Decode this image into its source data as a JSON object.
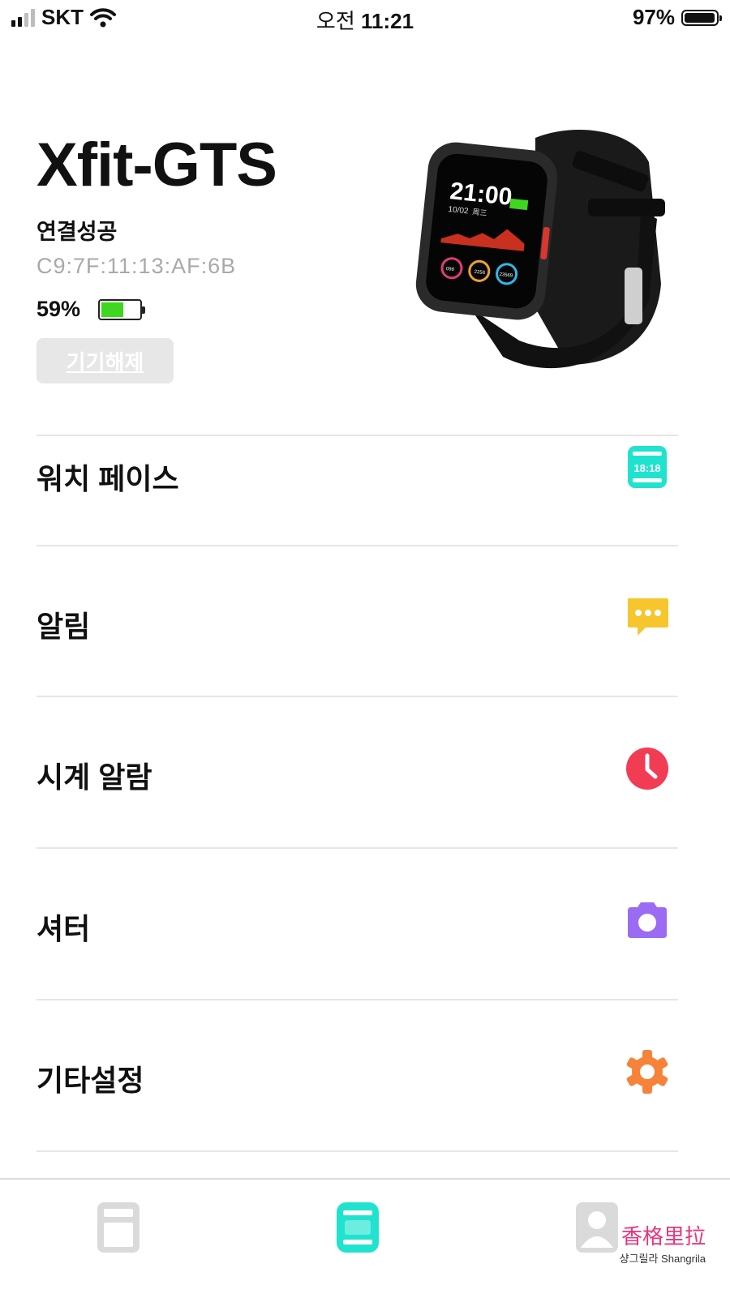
{
  "status_bar": {
    "carrier": "SKT",
    "time_prefix": "오전",
    "time": "11:21",
    "battery_percent": "97%"
  },
  "device": {
    "name": "Xfit-GTS",
    "connection_status": "연결성공",
    "mac_address": "C9:7F:11:13:AF:6B",
    "battery_label": "59%",
    "battery_level": 0.59,
    "unpair_label": "기기해제",
    "watch_screen": {
      "time": "21:00",
      "date": "10/02",
      "weekday": "周三",
      "stats": [
        "098",
        "2256",
        "23569"
      ]
    }
  },
  "menu": {
    "items": [
      {
        "label": "워치 페이스",
        "icon": "watch-face-icon",
        "color": "#1fe3cf"
      },
      {
        "label": "알림",
        "icon": "message-icon",
        "color": "#f7c62f"
      },
      {
        "label": "시계 알람",
        "icon": "clock-icon",
        "color": "#f23c54"
      },
      {
        "label": "셔터",
        "icon": "camera-icon",
        "color": "#9b6cf3"
      },
      {
        "label": "기타설정",
        "icon": "gear-icon",
        "color": "#f7823a"
      }
    ]
  },
  "watch_face_icon_text": "18:18",
  "tab_bar": {
    "tabs": [
      {
        "name": "data",
        "icon": "dashboard-icon",
        "active": false
      },
      {
        "name": "device",
        "icon": "watch-icon",
        "active": true
      },
      {
        "name": "profile",
        "icon": "user-icon",
        "active": false
      }
    ],
    "active_color": "#1fe3cf"
  },
  "watermark": {
    "chinese": "香格里拉",
    "subtitle": "샹그릴라 Shangrila"
  }
}
